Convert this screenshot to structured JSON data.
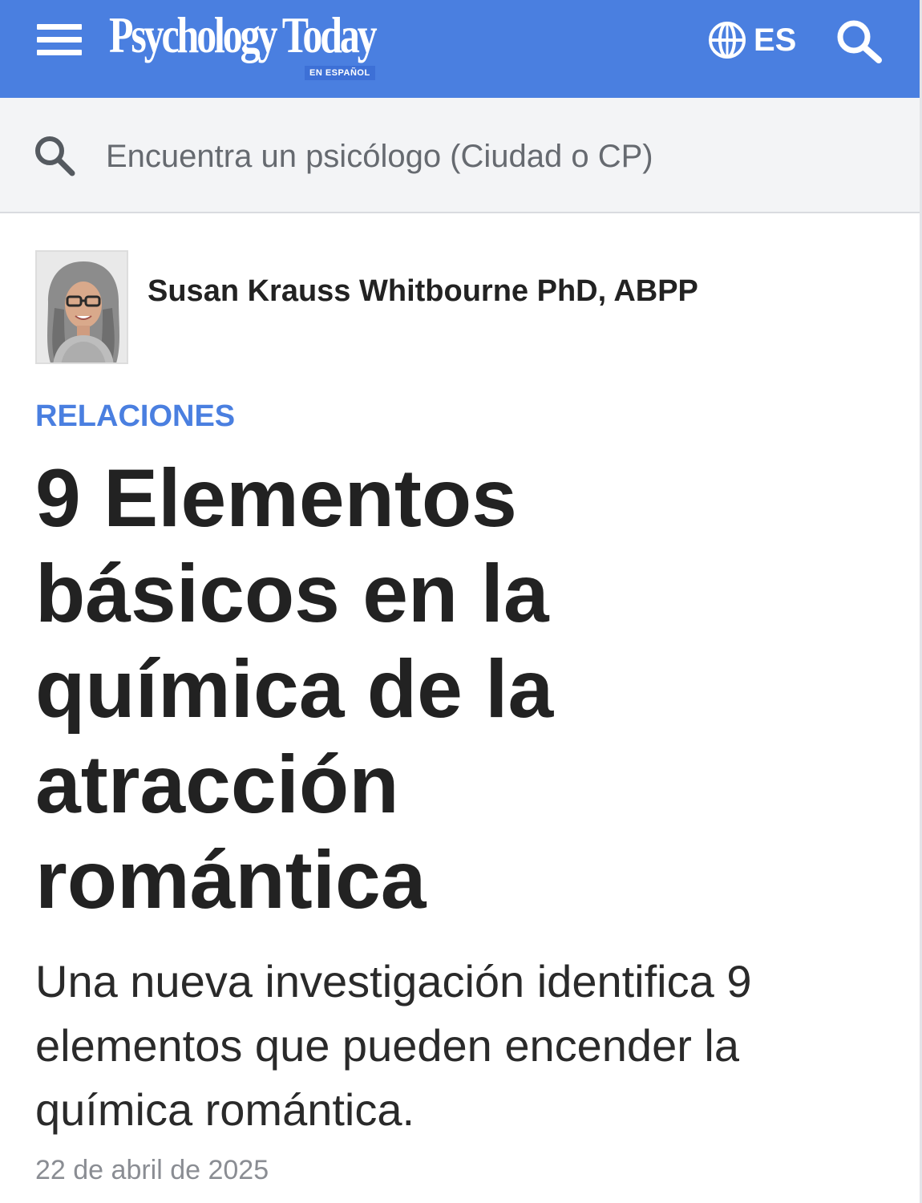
{
  "header": {
    "logo_text": "Psychology Today",
    "logo_subtitle": "EN ESPAÑOL",
    "language_label": "ES",
    "icons": {
      "menu": "hamburger-menu-icon",
      "language": "globe-icon",
      "search": "search-icon"
    },
    "colors": {
      "background": "#4a7fe0"
    }
  },
  "finder": {
    "placeholder": "Encuentra un psicólogo (Ciudad o CP)",
    "icon": "search-icon"
  },
  "article": {
    "author": "Susan Krauss Whitbourne PhD, ABPP",
    "category": "RELACIONES",
    "title": "9 Elementos básicos en la química de la atracción romántica",
    "subtitle": "Una nueva investigación identifica 9 elementos que pueden encender la química romántica.",
    "date": "22 de abril de 2025",
    "colors": {
      "category": "#4a7fe0",
      "text": "#222222",
      "date": "#8a8d93"
    }
  }
}
